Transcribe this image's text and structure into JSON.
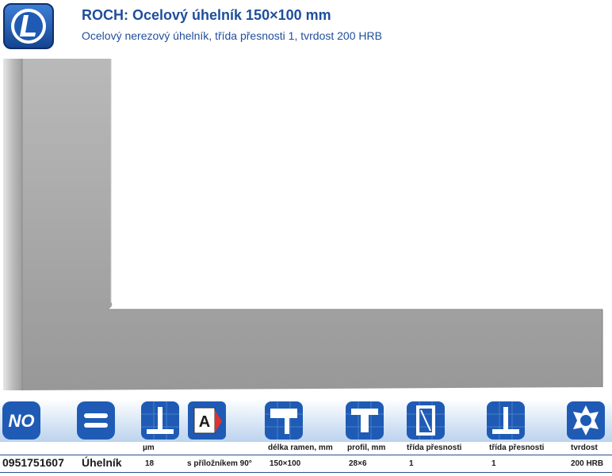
{
  "header": {
    "title": "ROCH: Ocelový úhelník 150×100 mm",
    "subtitle": "Ocelový nerezový úhelník, třída přesnosti 1, tvrdost 200 HRB"
  },
  "brand": {
    "logo_letter": "L",
    "accent": "#1f5bb5"
  },
  "icons": [
    {
      "icon": "no-logo-icon",
      "text": "NO"
    },
    {
      "icon": "equals-icon"
    },
    {
      "icon": "square-precision-icon"
    },
    {
      "icon": "a-card-icon",
      "text": "A"
    },
    {
      "icon": "arm-length-icon"
    },
    {
      "icon": "profile-icon"
    },
    {
      "icon": "precision-class-icon"
    },
    {
      "icon": "square-class-icon"
    },
    {
      "icon": "hardness-icon"
    }
  ],
  "columns": {
    "um": "µm",
    "arm_length": "délka ramen, mm",
    "profile": "profil, mm",
    "precision_1": "třída přesnosti",
    "precision_2": "třída přesnosti",
    "hardness": "tvrdost"
  },
  "row": {
    "code": "0951751607",
    "name": "Úhelník",
    "um": "18",
    "feature": "s příložníkem 90°",
    "arm_length": "150×100",
    "profile": "28×6",
    "precision_1": "1",
    "precision_2": "1",
    "hardness": "200 HRB"
  }
}
